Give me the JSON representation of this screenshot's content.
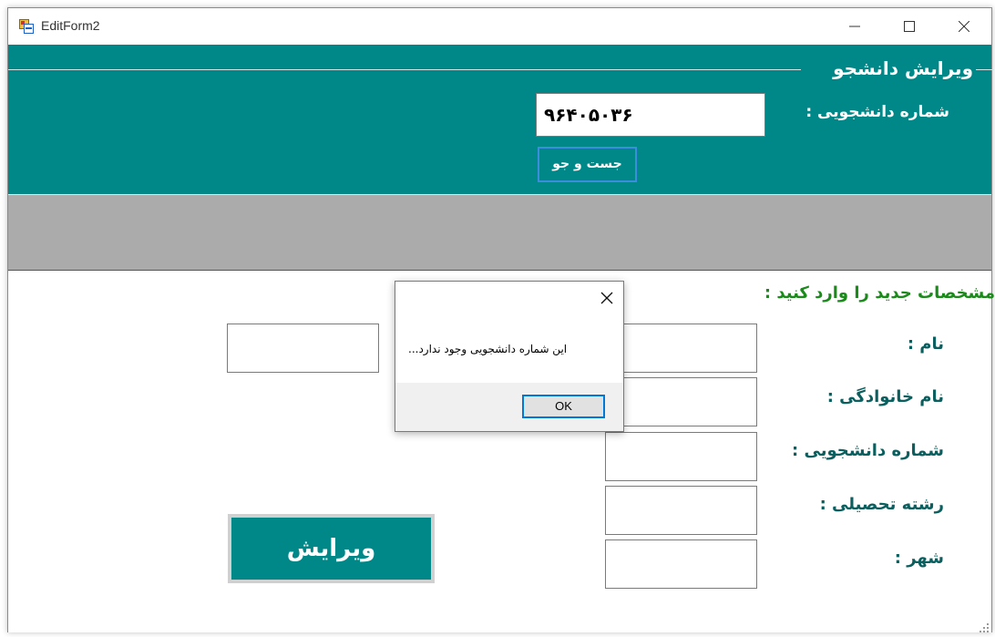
{
  "window": {
    "title": "EditForm2"
  },
  "header": {
    "group_title": "ویرایش دانشجو",
    "student_id_label": "شماره دانشجویی :",
    "student_id_value": "۹۶۴۰۵۰۳۶",
    "search_button": "جست و جو"
  },
  "form": {
    "instructions": "مشخصات جدید را وارد کنید :",
    "fields": [
      {
        "label": "نام :",
        "value": ""
      },
      {
        "label": "نام خانوادگی :",
        "value": ""
      },
      {
        "label": "شماره دانشجویی :",
        "value": ""
      },
      {
        "label": "رشته تحصیلی :",
        "value": ""
      },
      {
        "label": "شهر :",
        "value": ""
      }
    ],
    "edit_button": "ویرایش"
  },
  "dialog": {
    "message": "این شماره دانشجویی وجود ندارد...",
    "ok_button": "OK"
  },
  "colors": {
    "teal": "#008888",
    "gray_band": "#ababab",
    "green_text": "#1a8a1a",
    "focus_blue": "#0078d7"
  }
}
